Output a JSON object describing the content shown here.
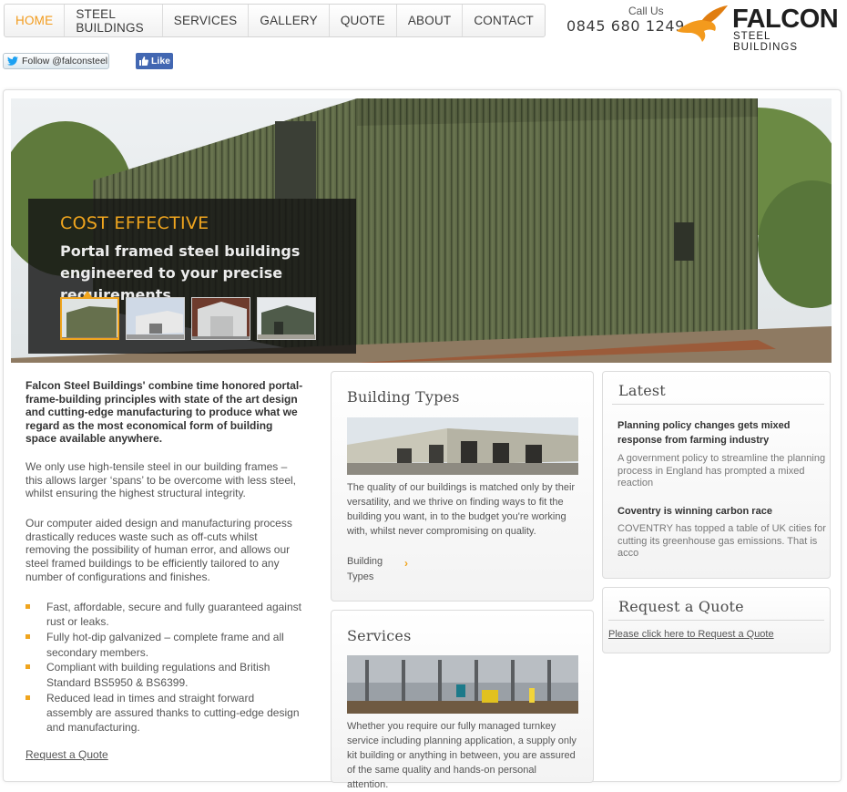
{
  "nav": {
    "items": [
      {
        "label": "HOME",
        "active": true
      },
      {
        "label": "STEEL BUILDINGS",
        "active": false
      },
      {
        "label": "SERVICES",
        "active": false
      },
      {
        "label": "GALLERY",
        "active": false
      },
      {
        "label": "QUOTE",
        "active": false
      },
      {
        "label": "ABOUT",
        "active": false
      },
      {
        "label": "CONTACT",
        "active": false
      }
    ]
  },
  "header": {
    "call_us": "Call Us",
    "phone": "0845 680 1249",
    "logo_word": "FALCON",
    "logo_sub": "STEEL BUILDINGS"
  },
  "social": {
    "twitter_label": "Follow @falconsteel",
    "facebook_label": "Like"
  },
  "hero": {
    "title": "COST EFFECTIVE",
    "subtitle": "Portal framed steel buildings engineered to your precise requirements…"
  },
  "intro": {
    "lead": "Falcon Steel Buildings' combine time honored portal-frame-building principles with state of the art design and cutting-edge manufacturing to produce what we regard as the most economical form of building space available anywhere.",
    "para1": "We only use high-tensile steel in our building frames – this allows larger ‘spans’ to be overcome with less steel, whilst ensuring the highest structural integrity.",
    "para2": "Our computer aided design and manufacturing process drastically reduces waste such as off-cuts whilst removing the possibility of human error, and allows our steel framed buildings to be efficiently tailored to any number of configurations and finishes.",
    "bullets": [
      "Fast, affordable, secure and fully guaranteed against rust or leaks.",
      "Fully hot-dip galvanized – complete frame and all secondary members.",
      "Compliant with building regulations and British Standard BS5950 & BS6399.",
      "Reduced lead in times and straight forward assembly are assured thanks to cutting-edge design and manufacturing."
    ],
    "request_link": "Request a Quote"
  },
  "building_types": {
    "title": "Building Types",
    "text": "The quality of our buildings is matched only by their versatility, and we thrive on finding ways to fit the building you want, in to the budget you're working with, whilst never compromising on quality.",
    "more_label": "Building Types"
  },
  "services": {
    "title": "Services",
    "text": "Whether you require our fully managed turnkey service including planning application, a supply only kit building or anything in between, you are assured of the same quality and hands-on personal attention."
  },
  "latest": {
    "title": "Latest",
    "items": [
      {
        "title": "Planning policy changes gets mixed response from farming industry",
        "body": "A government policy to streamline the planning process in England has prompted a mixed reaction"
      },
      {
        "title": "Coventry is winning carbon race",
        "body": "COVENTRY has topped a table of UK cities for cutting its greenhouse gas emissions. That is acco"
      }
    ]
  },
  "quote_box": {
    "title": "Request a Quote",
    "link": "Please click here to Request a Quote"
  },
  "colors": {
    "accent": "#f0a51e",
    "nav_active": "#f29b1c",
    "facebook": "#4267b2"
  }
}
